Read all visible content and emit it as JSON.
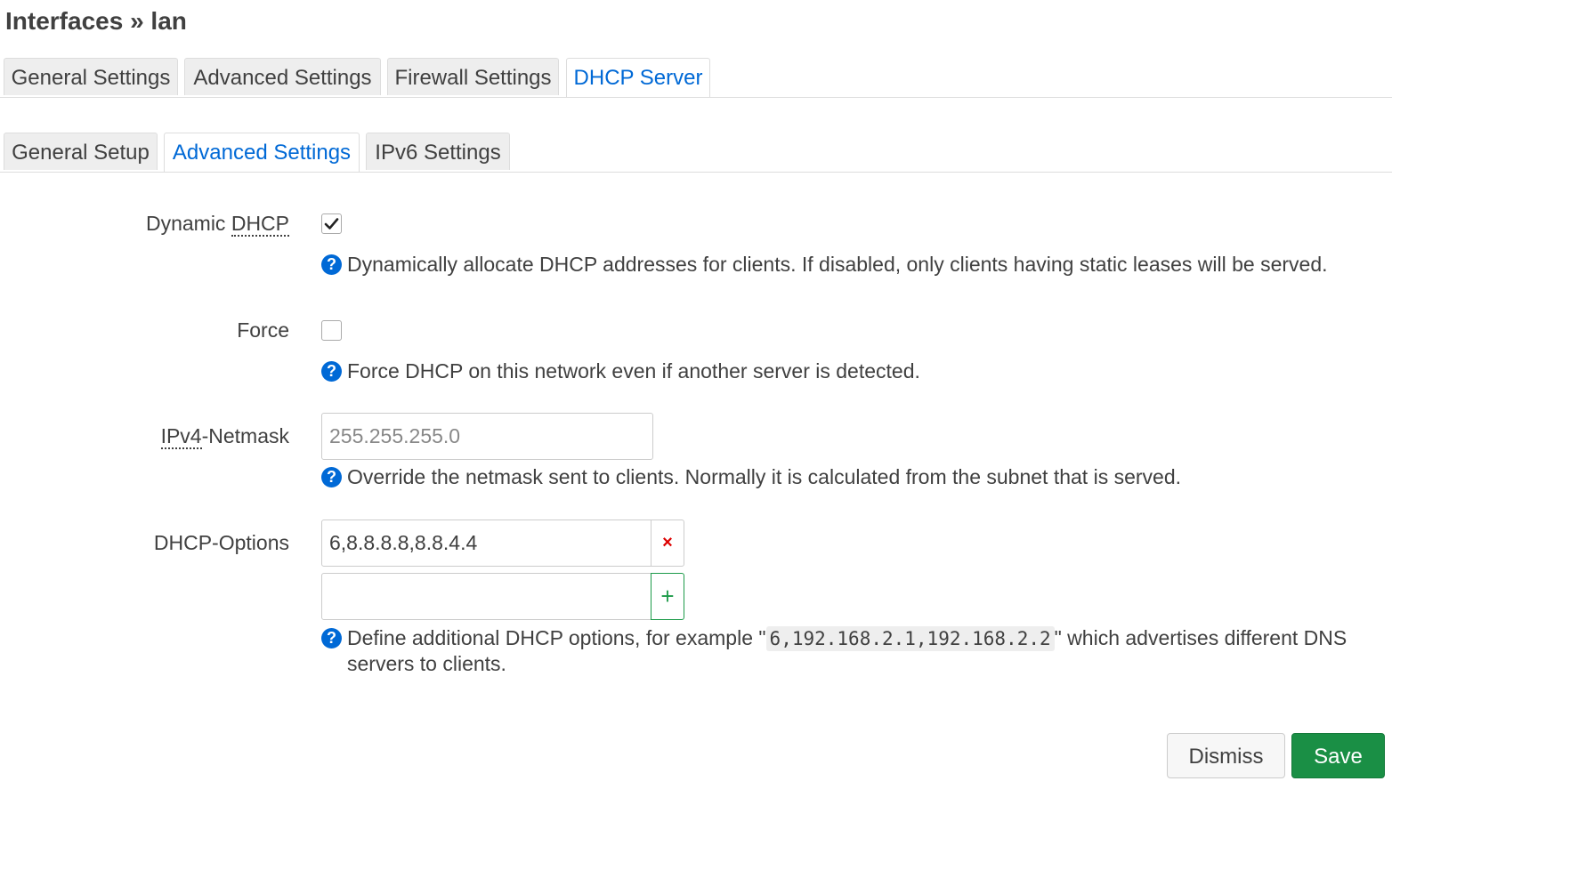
{
  "page_title": "Interfaces » lan",
  "main_tabs": [
    {
      "label": "General Settings",
      "active": false
    },
    {
      "label": "Advanced Settings",
      "active": false
    },
    {
      "label": "Firewall Settings",
      "active": false
    },
    {
      "label": "DHCP Server",
      "active": true
    }
  ],
  "sub_tabs": [
    {
      "label": "General Setup",
      "active": false
    },
    {
      "label": "Advanced Settings",
      "active": true
    },
    {
      "label": "IPv6 Settings",
      "active": false
    }
  ],
  "fields": {
    "dynamic_dhcp": {
      "label_plain": "Dynamic ",
      "label_abbr": "DHCP",
      "checked": true,
      "help": "Dynamically allocate DHCP addresses for clients. If disabled, only clients having static leases will be served."
    },
    "force": {
      "label": "Force",
      "checked": false,
      "help": "Force DHCP on this network even if another server is detected."
    },
    "netmask": {
      "label_abbr": "IPv4",
      "label_plain": "-Netmask",
      "placeholder": "255.255.255.0",
      "value": "",
      "help": "Override the netmask sent to clients. Normally it is calculated from the subnet that is served."
    },
    "dhcp_options": {
      "label": "DHCP-Options",
      "values": [
        "6,8.8.8.8,8.8.4.4",
        ""
      ],
      "help_prefix": "Define additional DHCP options, for example \"",
      "help_code": "6,192.168.2.1,192.168.2.2",
      "help_suffix_line1": "\" which advertises different DNS",
      "help_line2": "servers to clients."
    }
  },
  "icons": {
    "help": "question-circle-icon",
    "remove": "remove-x-icon",
    "add": "plus-icon",
    "check": "checkmark-icon"
  },
  "buttons": {
    "dismiss": "Dismiss",
    "save": "Save"
  },
  "colors": {
    "accent": "#0069d6",
    "save": "#1a8f45",
    "remove": "#dd0000",
    "add": "#1e9b4a"
  }
}
